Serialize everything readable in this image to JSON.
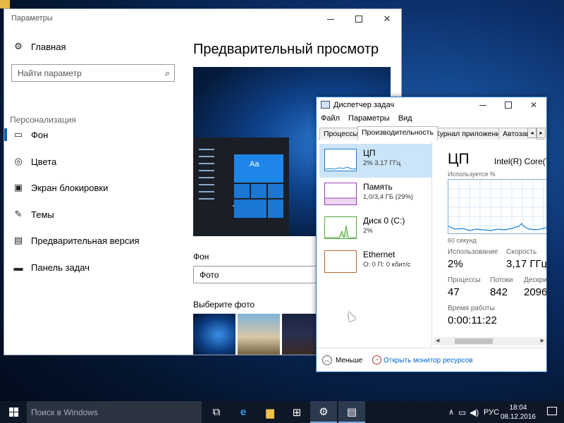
{
  "settings": {
    "window_title": "Параметры",
    "home_label": "Главная",
    "search_placeholder": "Найти параметр",
    "section_heading": "Персонализация",
    "nav_items": [
      {
        "label": "Фон",
        "icon": "image-icon",
        "active": true
      },
      {
        "label": "Цвета",
        "icon": "palette-icon",
        "active": false
      },
      {
        "label": "Экран блокировки",
        "icon": "lock-screen-icon",
        "active": false
      },
      {
        "label": "Темы",
        "icon": "brush-icon",
        "active": false
      },
      {
        "label": "Предварительная версия",
        "icon": "start-icon",
        "active": false
      },
      {
        "label": "Панель задач",
        "icon": "taskbar-icon",
        "active": false
      }
    ],
    "content_title": "Предварительный просмотр",
    "preview_tile_text": "Aa",
    "background_label": "Фон",
    "background_value": "Фото",
    "choose_photo_label": "Выберите фото"
  },
  "taskmgr": {
    "window_title": "Диспетчер задач",
    "menu": [
      "Файл",
      "Параметры",
      "Вид"
    ],
    "tabs": [
      "Процессы",
      "Производительность",
      "Журнал приложений",
      "Автозагр"
    ],
    "active_tab": "Производительность",
    "perf_items": [
      {
        "name": "ЦП",
        "value": "2% 3,17 ГГц",
        "color": "#1a7fd4"
      },
      {
        "name": "Память",
        "value": "1,0/3,4 ГБ (29%)",
        "color": "#9b3fb5"
      },
      {
        "name": "Диск 0 (C:)",
        "value": "2%",
        "color": "#4fa838"
      },
      {
        "name": "Ethernet",
        "value": "О: 0 П: 0 кбит/с",
        "color": "#b86a2e"
      }
    ],
    "cpu": {
      "heading": "ЦП",
      "model": "Intel(R) Core(T",
      "util_label": "Используется %",
      "graph_caption": "60 секунд",
      "stats": {
        "usage_label": "Использование",
        "usage_value": "2%",
        "speed_label": "Скорость",
        "speed_value": "3,17 ГГц",
        "processes_label": "Процессы",
        "processes_value": "47",
        "threads_label": "Потоки",
        "threads_value": "842",
        "handles_label": "Дескрип",
        "handles_value": "2096",
        "uptime_label": "Время работы",
        "uptime_value": "0:00:11:22"
      }
    },
    "footer": {
      "fewer_label": "Меньше",
      "resmon_label": "Открыть монитор ресурсов"
    }
  },
  "taskbar": {
    "search_placeholder": "Поиск в Windows",
    "lang": "РУС",
    "time": "18:04",
    "date": "08.12.2016",
    "tray_up": "∧"
  },
  "colors": {
    "accent": "#0063b1",
    "tile": "#1a78d4",
    "taskbar": "#0e1726"
  }
}
